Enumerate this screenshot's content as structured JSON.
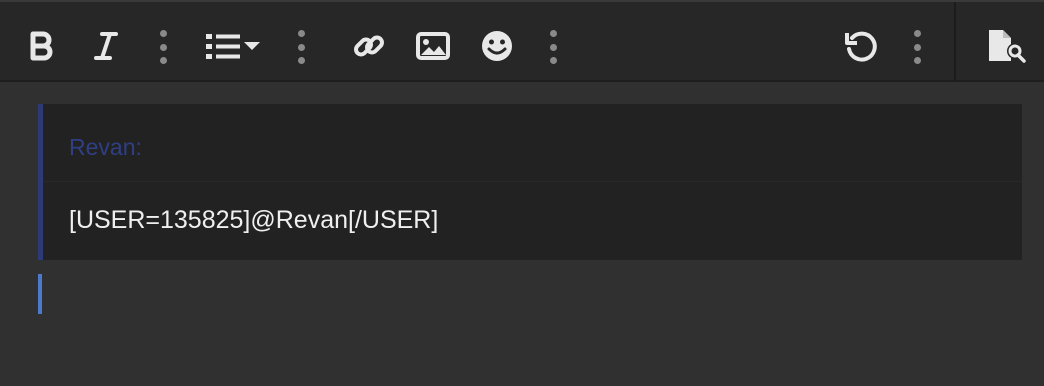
{
  "toolbar": {
    "buttons": [
      {
        "name": "bold",
        "icon": "bold-icon"
      },
      {
        "name": "italic",
        "icon": "italic-icon"
      },
      {
        "name": "list",
        "icon": "list-icon"
      },
      {
        "name": "link",
        "icon": "link-icon"
      },
      {
        "name": "image",
        "icon": "image-icon"
      },
      {
        "name": "emoji",
        "icon": "smiley-icon"
      },
      {
        "name": "undo",
        "icon": "undo-icon"
      },
      {
        "name": "preview",
        "icon": "file-search-icon"
      }
    ]
  },
  "quote": {
    "author": "Revan:",
    "body": "[USER=135825]@Revan[/USER]"
  },
  "colors": {
    "toolbar_bg": "#272727",
    "editor_bg": "#303030",
    "quote_bg": "#222222",
    "quote_accent": "#2c3a75",
    "caret": "#4c79cc"
  }
}
